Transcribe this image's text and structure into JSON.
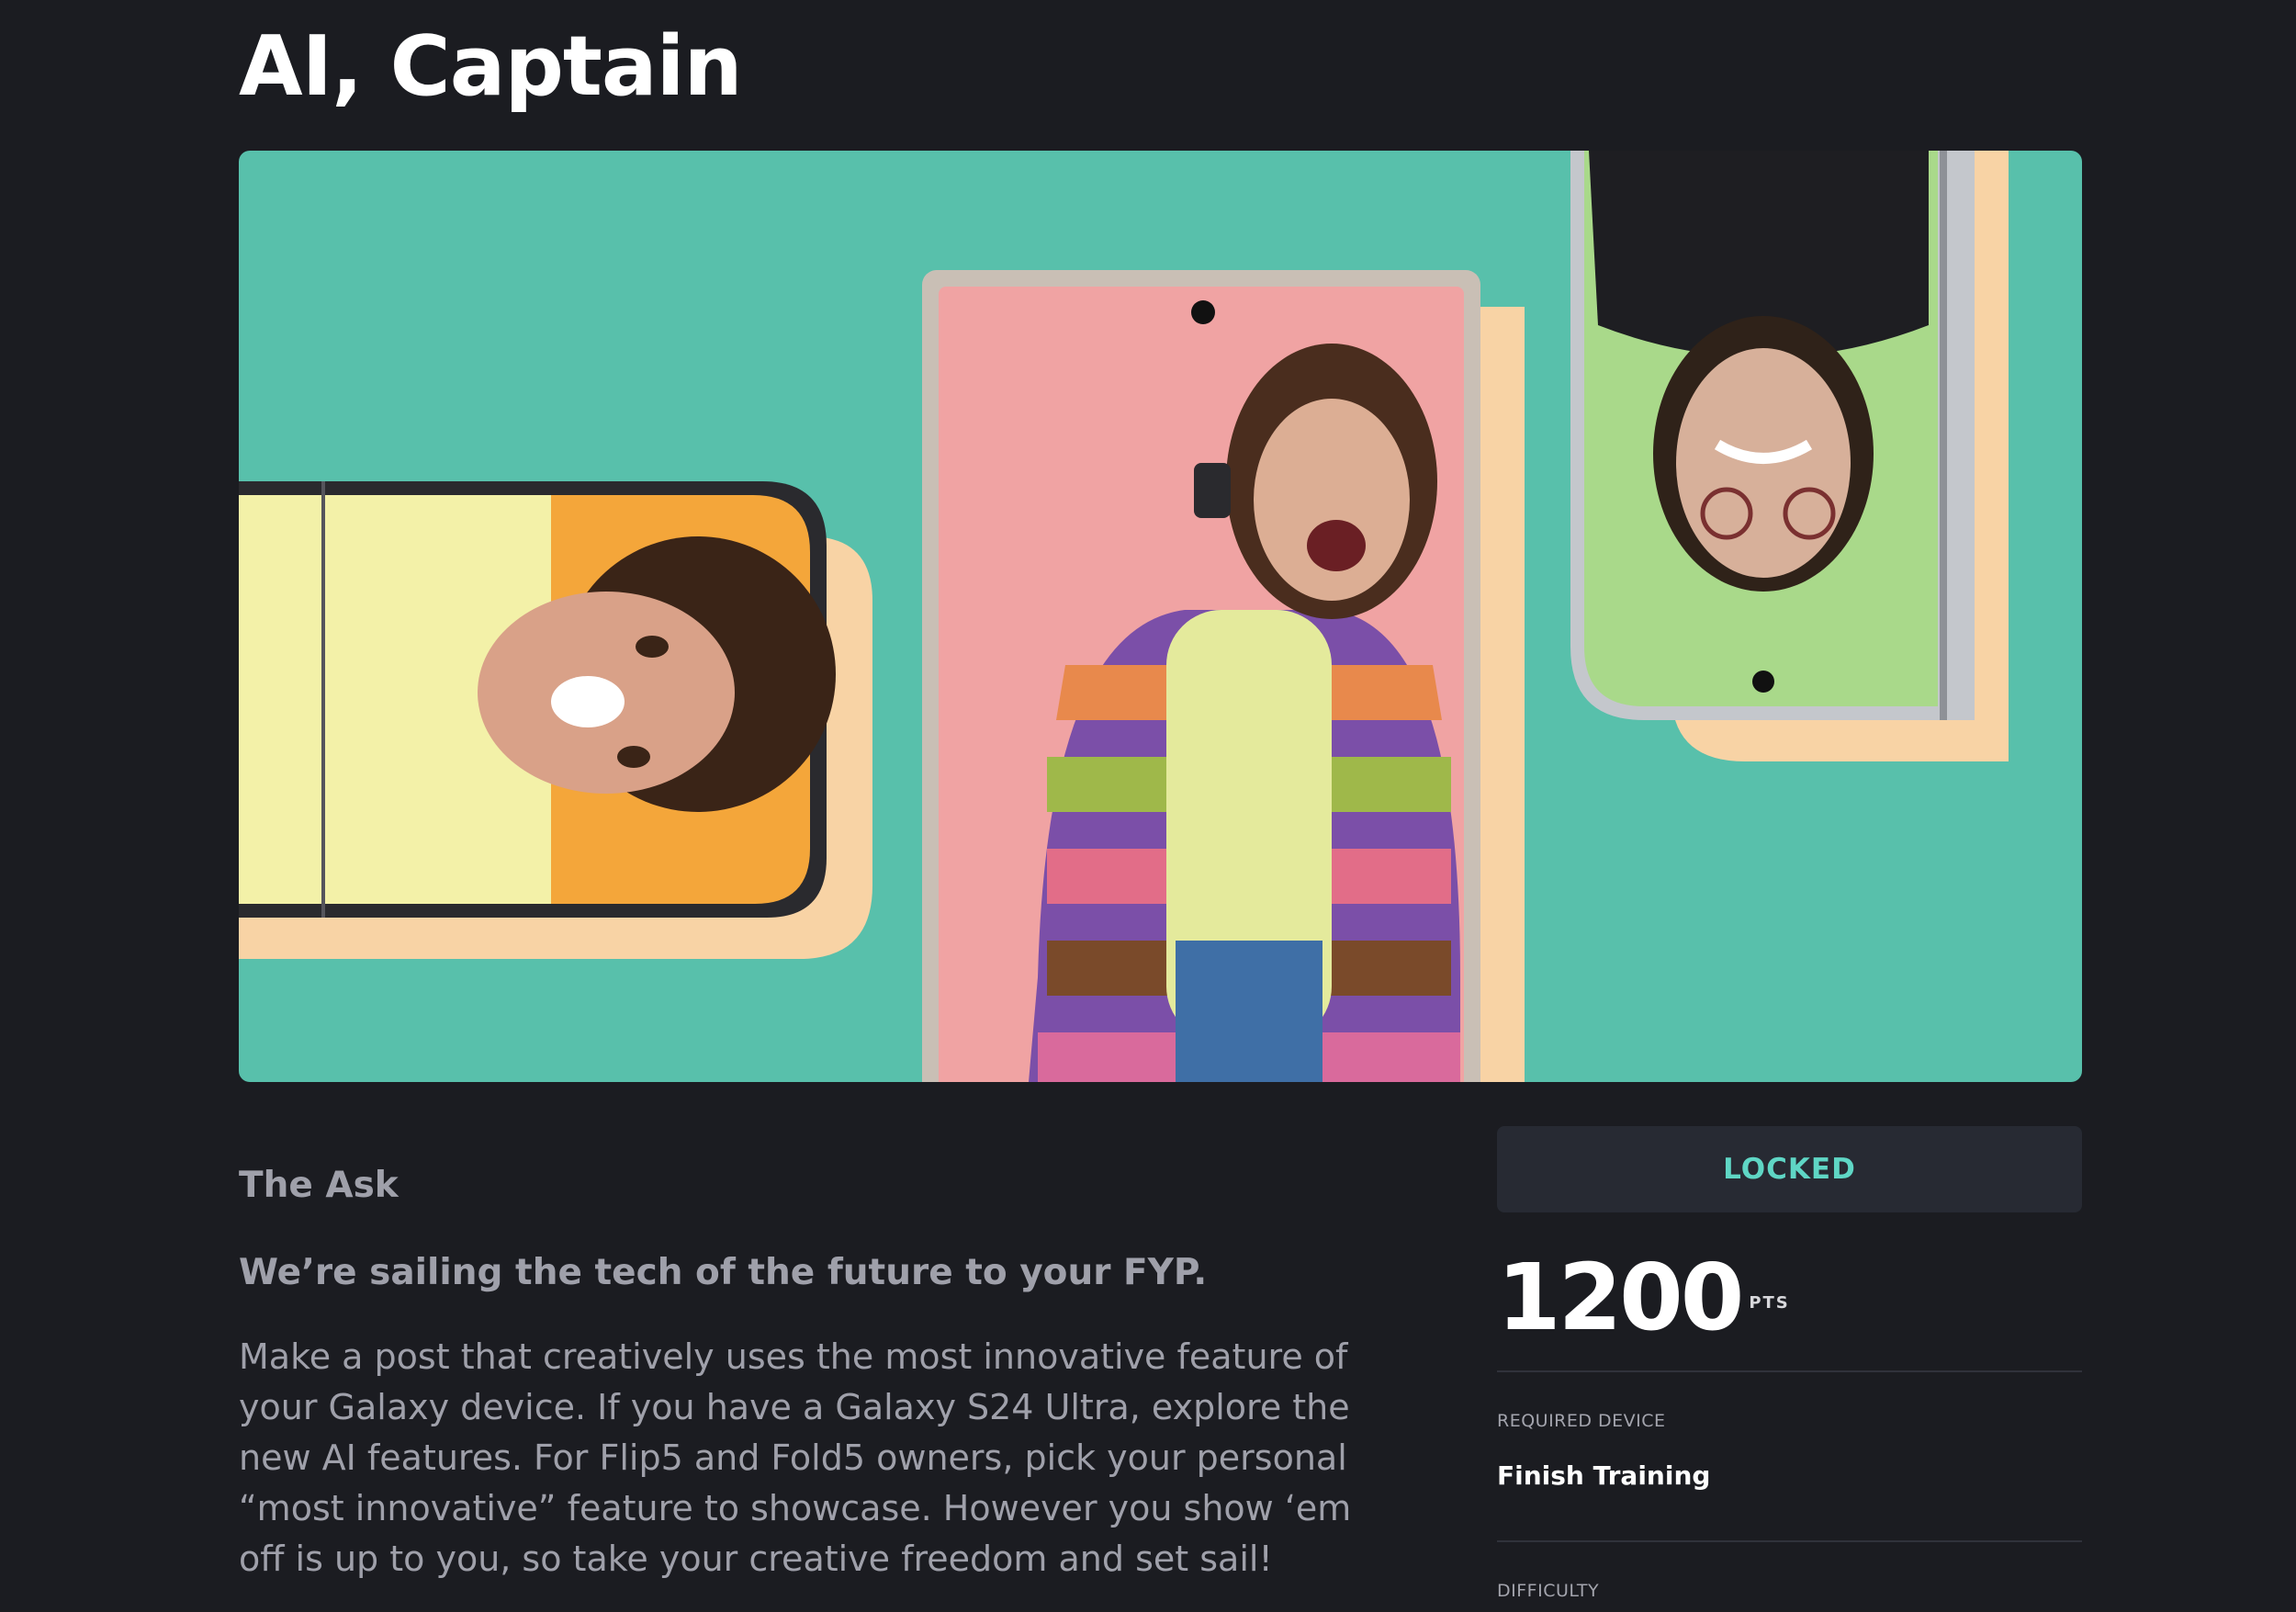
{
  "page": {
    "title": "AI, Captain"
  },
  "hero": {
    "background_color": "#58c0ab",
    "accent_color": "#f8d3a5",
    "screens": [
      {
        "description": "folded phone landscape - person with curly hair",
        "screen_color": "#f4a63a"
      },
      {
        "description": "tall phone portrait - person in striped cardigan",
        "screen_color": "#f0a3a3"
      },
      {
        "description": "folded phone inverted - person with glasses",
        "screen_color": "#a9d98a"
      }
    ]
  },
  "ask": {
    "heading": "The Ask",
    "subheading": "We’re sailing the tech of the future to your FYP.",
    "body": "Make a post that creatively uses the most innovative feature of your Galaxy device. If you have a Galaxy S24 Ultra, explore the new AI features. For Flip5 and Fold5 owners, pick your personal “most innovative” feature to showcase. However you show ‘em off is up to you, so take your creative freedom and set sail!"
  },
  "sidebar": {
    "status_label": "LOCKED",
    "points_value": "1200",
    "points_unit": "PTS",
    "required_device_label": "REQUIRED DEVICE",
    "required_device_value": "Finish Training",
    "difficulty_label": "DIFFICULTY"
  },
  "colors": {
    "page_background": "#1b1c21",
    "locked_text": "#5fd6c5",
    "muted_text": "#9fa0aa"
  }
}
